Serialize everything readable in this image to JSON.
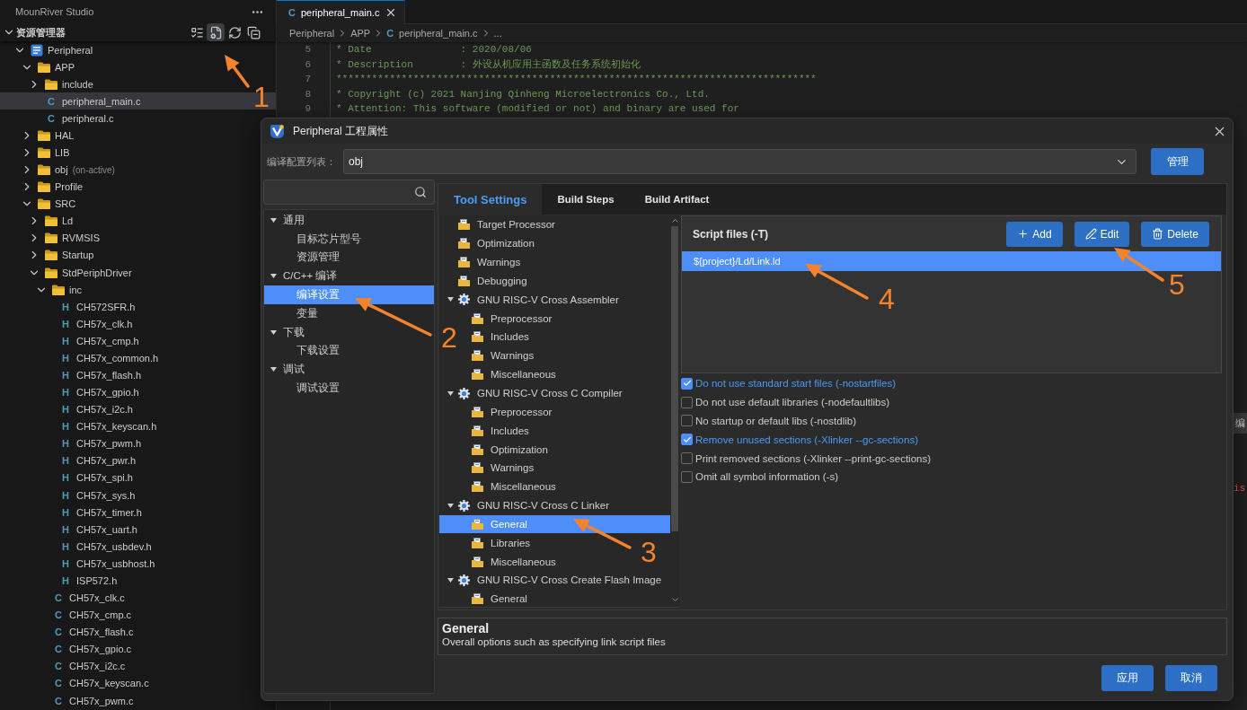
{
  "sidebar": {
    "title": "MounRiver Studio",
    "explorer": {
      "title": "资源管理器",
      "expanded": true,
      "actions": [
        {
          "selected": false
        },
        {
          "selected": true
        },
        {
          "selected": false
        },
        {
          "selected": false
        }
      ]
    },
    "tree": [
      {
        "kind": "project",
        "label": "Peripheral",
        "expanded": true,
        "selected": false,
        "children": [
          {
            "kind": "folder",
            "label": "APP",
            "expanded": true,
            "selected": false,
            "children": [
              {
                "kind": "folder",
                "label": "include",
                "expanded": false,
                "selected": false
              },
              {
                "kind": "file",
                "icon": "C",
                "label": "peripheral_main.c",
                "selected": true
              },
              {
                "kind": "file",
                "icon": "C",
                "label": "peripheral.c",
                "selected": false
              }
            ]
          },
          {
            "kind": "folder",
            "label": "HAL",
            "expanded": false,
            "selected": false
          },
          {
            "kind": "folder",
            "label": "LIB",
            "expanded": false,
            "selected": false
          },
          {
            "kind": "folder",
            "label": "obj",
            "note": "(on-active)",
            "expanded": false,
            "selected": false
          },
          {
            "kind": "folder",
            "label": "Profile",
            "expanded": false,
            "selected": false
          },
          {
            "kind": "folder",
            "label": "SRC",
            "expanded": true,
            "selected": false,
            "children": [
              {
                "kind": "folder",
                "label": "Ld",
                "expanded": false,
                "selected": false
              },
              {
                "kind": "folder",
                "label": "RVMSIS",
                "expanded": false,
                "selected": false
              },
              {
                "kind": "folder",
                "label": "Startup",
                "expanded": false,
                "selected": false
              },
              {
                "kind": "folder",
                "label": "StdPeriphDriver",
                "expanded": true,
                "selected": false,
                "children": [
                  {
                    "kind": "folder",
                    "label": "inc",
                    "expanded": true,
                    "selected": false,
                    "children": [
                      {
                        "kind": "file",
                        "icon": "H",
                        "label": "CH572SFR.h",
                        "selected": false
                      },
                      {
                        "kind": "file",
                        "icon": "H",
                        "label": "CH57x_clk.h",
                        "selected": false
                      },
                      {
                        "kind": "file",
                        "icon": "H",
                        "label": "CH57x_cmp.h",
                        "selected": false
                      },
                      {
                        "kind": "file",
                        "icon": "H",
                        "label": "CH57x_common.h",
                        "selected": false
                      },
                      {
                        "kind": "file",
                        "icon": "H",
                        "label": "CH57x_flash.h",
                        "selected": false
                      },
                      {
                        "kind": "file",
                        "icon": "H",
                        "label": "CH57x_gpio.h",
                        "selected": false
                      },
                      {
                        "kind": "file",
                        "icon": "H",
                        "label": "CH57x_i2c.h",
                        "selected": false
                      },
                      {
                        "kind": "file",
                        "icon": "H",
                        "label": "CH57x_keyscan.h",
                        "selected": false
                      },
                      {
                        "kind": "file",
                        "icon": "H",
                        "label": "CH57x_pwm.h",
                        "selected": false
                      },
                      {
                        "kind": "file",
                        "icon": "H",
                        "label": "CH57x_pwr.h",
                        "selected": false
                      },
                      {
                        "kind": "file",
                        "icon": "H",
                        "label": "CH57x_spi.h",
                        "selected": false
                      },
                      {
                        "kind": "file",
                        "icon": "H",
                        "label": "CH57x_sys.h",
                        "selected": false
                      },
                      {
                        "kind": "file",
                        "icon": "H",
                        "label": "CH57x_timer.h",
                        "selected": false
                      },
                      {
                        "kind": "file",
                        "icon": "H",
                        "label": "CH57x_uart.h",
                        "selected": false
                      },
                      {
                        "kind": "file",
                        "icon": "H",
                        "label": "CH57x_usbdev.h",
                        "selected": false
                      },
                      {
                        "kind": "file",
                        "icon": "H",
                        "label": "CH57x_usbhost.h",
                        "selected": false
                      },
                      {
                        "kind": "file",
                        "icon": "H",
                        "label": "ISP572.h",
                        "selected": false
                      }
                    ]
                  },
                  {
                    "kind": "file",
                    "icon": "C",
                    "label": "CH57x_clk.c",
                    "selected": false
                  },
                  {
                    "kind": "file",
                    "icon": "C",
                    "label": "CH57x_cmp.c",
                    "selected": false
                  },
                  {
                    "kind": "file",
                    "icon": "C",
                    "label": "CH57x_flash.c",
                    "selected": false
                  },
                  {
                    "kind": "file",
                    "icon": "C",
                    "label": "CH57x_gpio.c",
                    "selected": false
                  },
                  {
                    "kind": "file",
                    "icon": "C",
                    "label": "CH57x_i2c.c",
                    "selected": false
                  },
                  {
                    "kind": "file",
                    "icon": "C",
                    "label": "CH57x_keyscan.c",
                    "selected": false
                  },
                  {
                    "kind": "file",
                    "icon": "C",
                    "label": "CH57x_pwm.c",
                    "selected": false
                  }
                ]
              }
            ]
          }
        ]
      }
    ]
  },
  "editor": {
    "tabs": [
      {
        "icon": "C",
        "label": "peripheral_main.c",
        "selected": true
      }
    ],
    "breadcrumb": [
      {
        "label": "Peripheral"
      },
      {
        "label": "APP"
      },
      {
        "icon": "C",
        "label": "peripheral_main.c"
      },
      {
        "label": "..."
      }
    ],
    "lines": [
      {
        "number": "5",
        "text": "* Date               : 2020/08/06"
      },
      {
        "number": "6",
        "text": "* Description        : 外设从机应用主函数及任务系统初始化"
      },
      {
        "number": "7",
        "text": "*********************************************************************************"
      },
      {
        "number": "8",
        "text": "* Copyright (c) 2021 Nanjing Qinheng Microelectronics Co., Ltd."
      },
      {
        "number": "9",
        "text": "* Attention: This software (modified or not) and binary are used for"
      }
    ],
    "right_edge_fragments": [
      {
        "kind": "tab",
        "text": "编"
      },
      {
        "kind": "code",
        "text": "is"
      }
    ]
  },
  "dialog": {
    "title": "Peripheral 工程属性",
    "config": {
      "label": "编译配置列表：",
      "value": "obj",
      "button": "管理"
    },
    "nav": [
      {
        "label": "通用",
        "expanded": true,
        "selected": false,
        "children": [
          {
            "label": "目标芯片型号",
            "selected": false
          },
          {
            "label": "资源管理",
            "selected": false
          }
        ]
      },
      {
        "label": "C/C++ 编译",
        "expanded": true,
        "selected": false,
        "children": [
          {
            "label": "编译设置",
            "selected": true
          },
          {
            "label": "变量",
            "selected": false
          }
        ]
      },
      {
        "label": "下载",
        "expanded": true,
        "selected": false,
        "children": [
          {
            "label": "下载设置",
            "selected": false
          }
        ]
      },
      {
        "label": "调试",
        "expanded": true,
        "selected": false,
        "children": [
          {
            "label": "调试设置",
            "selected": false
          }
        ]
      }
    ],
    "tabs": [
      {
        "label": "Tool Settings",
        "selected": true
      },
      {
        "label": "Build Steps",
        "selected": false
      },
      {
        "label": "Build Artifact",
        "selected": false
      }
    ],
    "settings_tree": [
      {
        "kind": "page",
        "label": "Target Processor",
        "selected": false
      },
      {
        "kind": "page",
        "label": "Optimization",
        "selected": false
      },
      {
        "kind": "page",
        "label": "Warnings",
        "selected": false
      },
      {
        "kind": "page",
        "label": "Debugging",
        "selected": false
      },
      {
        "kind": "tool",
        "label": "GNU RISC-V Cross Assembler",
        "expanded": true,
        "selected": false,
        "children": [
          {
            "kind": "page",
            "label": "Preprocessor",
            "selected": false
          },
          {
            "kind": "page",
            "label": "Includes",
            "selected": false
          },
          {
            "kind": "page",
            "label": "Warnings",
            "selected": false
          },
          {
            "kind": "page",
            "label": "Miscellaneous",
            "selected": false
          }
        ]
      },
      {
        "kind": "tool",
        "label": "GNU RISC-V Cross C Compiler",
        "expanded": true,
        "selected": false,
        "children": [
          {
            "kind": "page",
            "label": "Preprocessor",
            "selected": false
          },
          {
            "kind": "page",
            "label": "Includes",
            "selected": false
          },
          {
            "kind": "page",
            "label": "Optimization",
            "selected": false
          },
          {
            "kind": "page",
            "label": "Warnings",
            "selected": false
          },
          {
            "kind": "page",
            "label": "Miscellaneous",
            "selected": false
          }
        ]
      },
      {
        "kind": "tool",
        "label": "GNU RISC-V Cross C Linker",
        "expanded": true,
        "selected": false,
        "children": [
          {
            "kind": "page",
            "label": "General",
            "selected": true
          },
          {
            "kind": "page",
            "label": "Libraries",
            "selected": false
          },
          {
            "kind": "page",
            "label": "Miscellaneous",
            "selected": false
          }
        ]
      },
      {
        "kind": "tool",
        "label": "GNU RISC-V Cross Create Flash Image",
        "expanded": true,
        "selected": false,
        "children": [
          {
            "kind": "page",
            "label": "General",
            "selected": false
          }
        ]
      }
    ],
    "script_files": {
      "title": "Script files (-T)",
      "buttons": [
        {
          "kind": "add",
          "label": "Add"
        },
        {
          "kind": "edit",
          "label": "Edit"
        },
        {
          "kind": "delete",
          "label": "Delete"
        }
      ],
      "items": [
        {
          "label": "${project}/Ld/Link.ld",
          "selected": true
        }
      ]
    },
    "options": [
      {
        "label": "Do not use standard start files (-nostartfiles)",
        "checked": true
      },
      {
        "label": "Do not use default libraries (-nodefaultlibs)",
        "checked": false
      },
      {
        "label": "No startup or default libs (-nostdlib)",
        "checked": false
      },
      {
        "label": "Remove unused sections (-Xlinker --gc-sections)",
        "checked": true
      },
      {
        "label": "Print removed sections (-Xlinker --print-gc-sections)",
        "checked": false
      },
      {
        "label": "Omit all symbol information (-s)",
        "checked": false
      }
    ],
    "description": {
      "title": "General",
      "text": "Overall options such as specifying link script files"
    },
    "buttons": [
      "应用",
      "取消"
    ]
  },
  "annotations": [
    {
      "label": "1"
    },
    {
      "label": "2"
    },
    {
      "label": "3"
    },
    {
      "label": "4"
    },
    {
      "label": "5"
    }
  ]
}
